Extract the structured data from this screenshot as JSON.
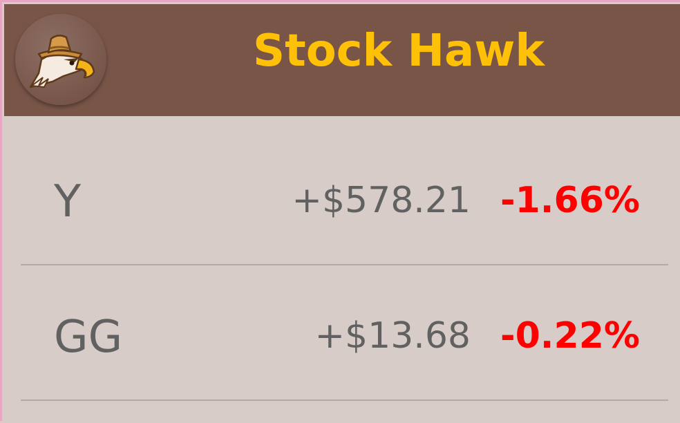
{
  "app_bar": {
    "title": "Stock Hawk",
    "logo_icon": "hawk-logo-icon",
    "background_color": "#795548",
    "title_color": "#ffc107"
  },
  "stocks": [
    {
      "symbol": "Y",
      "price": "+$578.21",
      "change": "-1.66%",
      "change_color": "#ff0000"
    },
    {
      "symbol": "GG",
      "price": "+$13.68",
      "change": "-0.22%",
      "change_color": "#ff0000"
    }
  ]
}
